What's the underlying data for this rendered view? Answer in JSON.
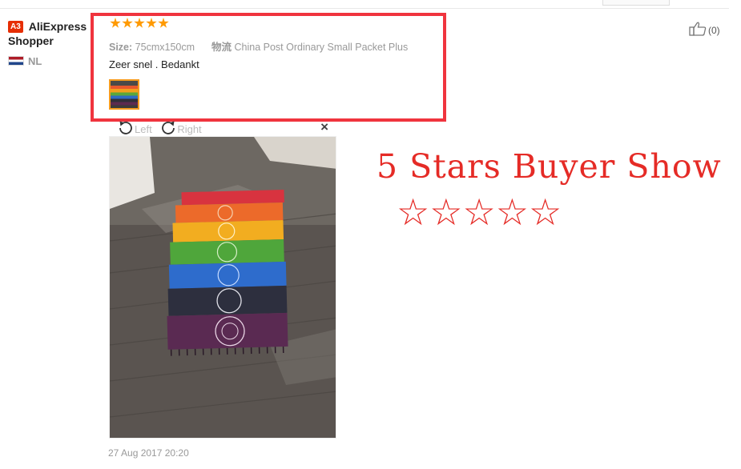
{
  "user": {
    "level_badge": "A3",
    "name": "AliExpress Shopper",
    "country_code": "NL",
    "flag_icon": "netherlands-flag-icon"
  },
  "review": {
    "rating": 5,
    "rating_max": 5,
    "star_color": "#ff9a00",
    "size_label": "Size:",
    "size_value": "75cmx150cm",
    "shipping_label": "物流",
    "shipping_value": "China Post Ordinary Small Packet Plus",
    "text": "Zeer snel . Bedankt",
    "date": "27 Aug 2017 20:20"
  },
  "like": {
    "icon": "thumbs-up-icon",
    "count": "(0)"
  },
  "viewer": {
    "rotate_left_label": "Left",
    "rotate_right_label": "Right",
    "close_label": "×",
    "rotate_left_icon": "rotate-left-icon",
    "rotate_right_icon": "rotate-right-icon"
  },
  "overlay": {
    "title": "5 Stars Buyer Show",
    "stars": "☆☆☆☆☆",
    "color": "#e52b26"
  },
  "colors": {
    "highlight_border": "#f0343e",
    "level_badge_bg": "#e62e04",
    "thumb_border": "#f59b1f"
  }
}
